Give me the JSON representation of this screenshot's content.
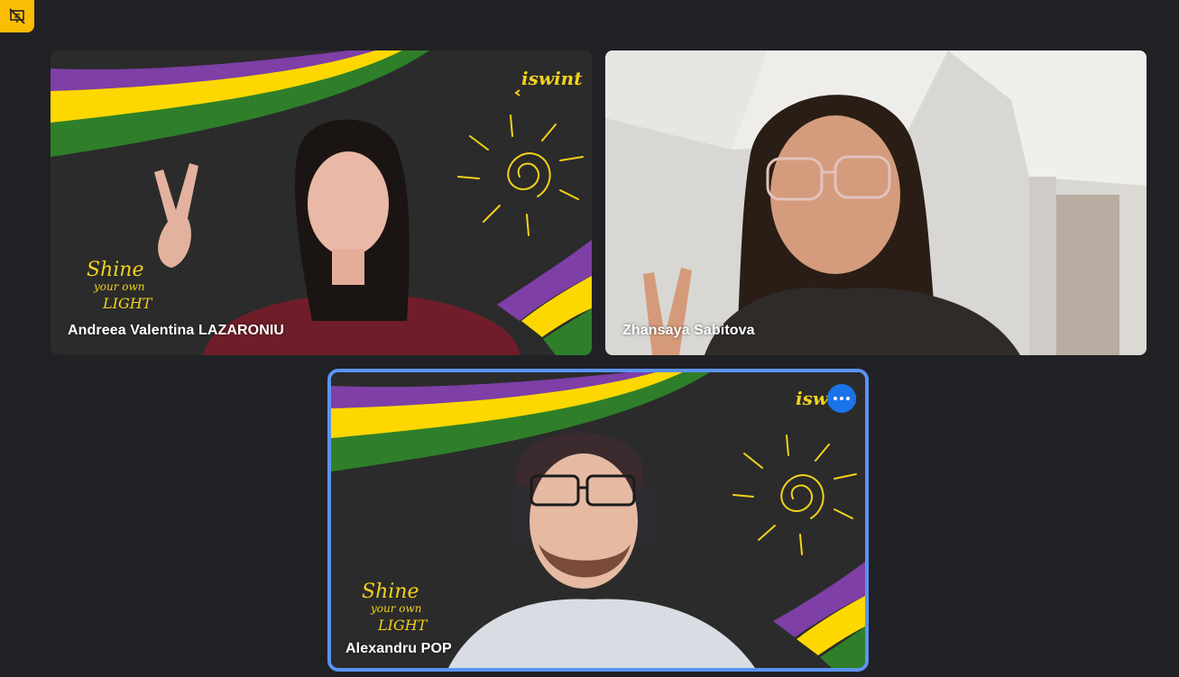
{
  "meeting": {
    "status_icon": "presentation-off-icon",
    "accent_color": "#fbbc04",
    "active_outline_color": "#5b93f2"
  },
  "participants": [
    {
      "name": "Andreea Valentina LAZARONIU",
      "background": "chalkboard-iswint",
      "active": false
    },
    {
      "name": "Zhansaya Sabitova",
      "background": "room-camera",
      "active": false
    },
    {
      "name": "Alexandru POP",
      "background": "chalkboard-iswint",
      "active": true,
      "menu_icon": "more-options-icon"
    }
  ],
  "brand": {
    "logo_text": "iswint",
    "slogan_lines": [
      "Shine",
      "your own",
      "LIGHT"
    ],
    "ribbon_colors": [
      "#7e3fa6",
      "#fdd800",
      "#2f7f2a"
    ]
  }
}
